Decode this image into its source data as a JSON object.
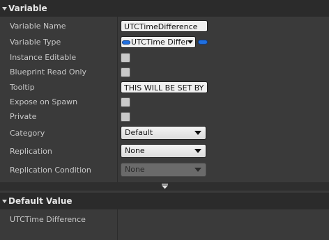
{
  "variable_section": {
    "title": "Variable",
    "rows": {
      "variable_name": {
        "label": "Variable Name",
        "value": "UTCTimeDifference"
      },
      "variable_type": {
        "label": "Variable Type",
        "value": "UTCTime Differ"
      },
      "instance_editable": {
        "label": "Instance Editable"
      },
      "blueprint_read_only": {
        "label": "Blueprint Read Only"
      },
      "tooltip": {
        "label": "Tooltip",
        "value": "THIS WILL BE SET BY F"
      },
      "expose_on_spawn": {
        "label": "Expose on Spawn"
      },
      "private": {
        "label": "Private"
      },
      "category": {
        "label": "Category",
        "value": "Default"
      },
      "replication": {
        "label": "Replication",
        "value": "None"
      },
      "replication_condition": {
        "label": "Replication Condition",
        "value": "None"
      }
    }
  },
  "default_value_section": {
    "title": "Default Value",
    "rows": {
      "utc_time_difference": {
        "label": "UTCTime Difference"
      }
    }
  },
  "colors": {
    "header_bg": "#2b2b2b",
    "panel_bg": "#3a3a3a",
    "type_pill": "#1f6fe0"
  }
}
